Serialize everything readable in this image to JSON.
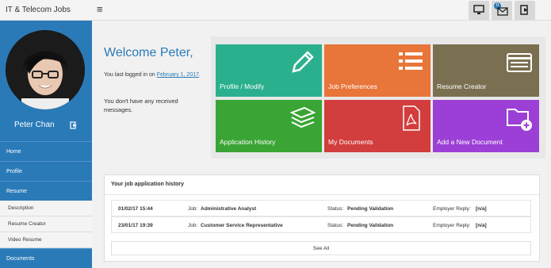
{
  "header": {
    "brand": "IT & Telecom Jobs",
    "menu_icon": "≡",
    "notification_count": "0"
  },
  "sidebar": {
    "user_name": "Peter Chan",
    "nav": [
      {
        "label": "Home"
      },
      {
        "label": "Profile"
      },
      {
        "label": "Resume"
      }
    ],
    "resume_sub": [
      {
        "label": "Description"
      },
      {
        "label": "Resume Creator"
      },
      {
        "label": "Video Resume"
      }
    ],
    "documents": "Documents"
  },
  "welcome": {
    "title": "Welcome Peter,",
    "last_login_prefix": "You last logged in on ",
    "last_login_date": "February 1, 2017",
    "last_login_suffix": ".",
    "messages": "You don't have any received messages."
  },
  "tiles": [
    {
      "label": "Profile / Modify",
      "color": "#2bb08d",
      "icon": "pencil-icon"
    },
    {
      "label": "Job Preferences",
      "color": "#e8753a",
      "icon": "list-icon"
    },
    {
      "label": "Resume Creator",
      "color": "#7a6f50",
      "icon": "id-card-icon"
    },
    {
      "label": "Application History",
      "color": "#3aa534",
      "icon": "stack-icon"
    },
    {
      "label": "My Documents",
      "color": "#d23d3d",
      "icon": "pdf-icon"
    },
    {
      "label": "Add a New Document",
      "color": "#9c3fd6",
      "icon": "add-folder-icon"
    }
  ],
  "history": {
    "title": "Your job application history",
    "rows": [
      {
        "date": "01/02/17 15:44",
        "job_label": "Job:",
        "job": "Administrative Analyst",
        "status_label": "Status:",
        "status": "Pending Validation",
        "reply_label": "Employer Reply:",
        "reply": "[n/a]"
      },
      {
        "date": "23/01/17 19:39",
        "job_label": "Job:",
        "job": "Customer Service Representative",
        "status_label": "Status:",
        "status": "Pending Validation",
        "reply_label": "Employer Reply:",
        "reply": "[n/a]"
      }
    ],
    "see_all": "See All"
  },
  "colors": {
    "primary": "#2a7ab8"
  }
}
